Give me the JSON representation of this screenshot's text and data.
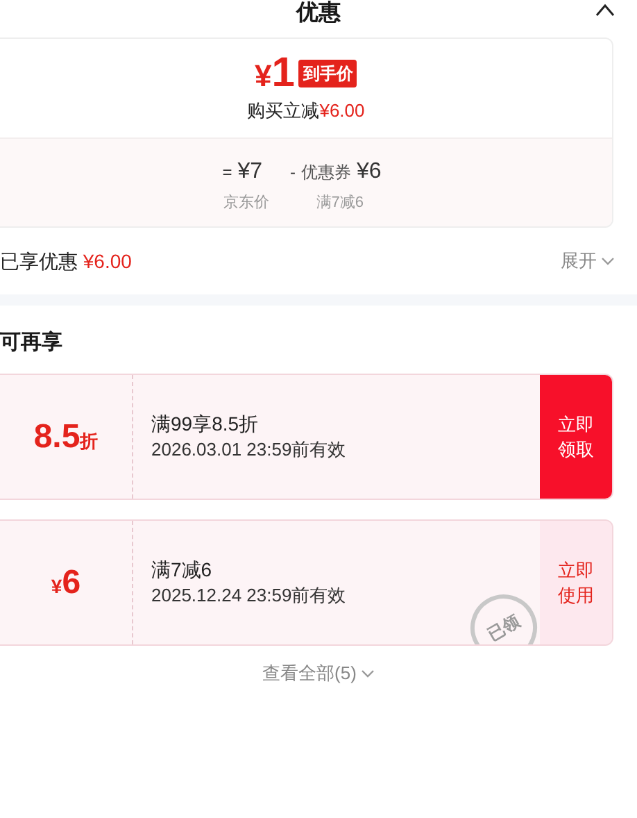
{
  "title": "优惠",
  "final_price": {
    "currency": "¥",
    "amount": "1",
    "badge": "到手价",
    "saving_label": "购买立减",
    "saving_amount": "¥6.00"
  },
  "breakdown": [
    {
      "sign": "=",
      "value": "¥7",
      "caption": "京东价"
    },
    {
      "sign": "-",
      "value": "¥6",
      "prefix": "优惠券",
      "caption": "满7减6"
    }
  ],
  "enjoyed": {
    "label": "已享优惠",
    "amount": "¥6.00",
    "toggle": "展开"
  },
  "section_title": "可再享",
  "coupons": [
    {
      "kind": "discount",
      "value": "8.5",
      "unit": "折",
      "condition": "满99享8.5折",
      "validity": "2026.03.01 23:59前有效",
      "action": "立即领取",
      "claimed": false
    },
    {
      "kind": "amount",
      "value": "6",
      "unit": "¥",
      "condition": "满7减6",
      "validity": "2025.12.24 23:59前有效",
      "action": "立即使用",
      "claimed": true,
      "stamp": "已领"
    }
  ],
  "view_all": "查看全部(5)"
}
